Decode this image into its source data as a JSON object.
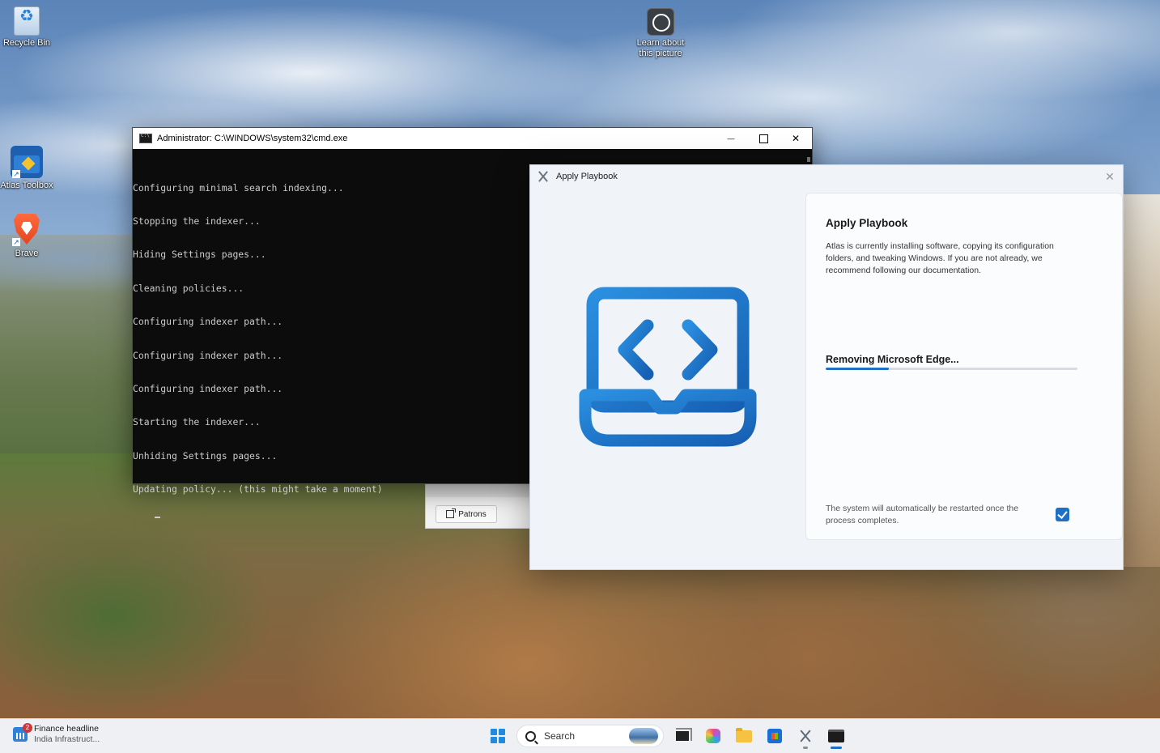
{
  "desktop": {
    "icons": [
      {
        "label": "Recycle Bin"
      },
      {
        "label": "Atlas Toolbox"
      },
      {
        "label": "Brave"
      },
      {
        "label": "Learn about this picture"
      }
    ]
  },
  "cmd": {
    "title": "Administrator: C:\\WINDOWS\\system32\\cmd.exe",
    "lines": [
      "Configuring minimal search indexing...",
      "Stopping the indexer...",
      "Hiding Settings pages...",
      "Cleaning policies...",
      "Configuring indexer path...",
      "Configuring indexer path...",
      "Configuring indexer path...",
      "Starting the indexer...",
      "Unhiding Settings pages...",
      "Updating policy... (this might take a moment)"
    ],
    "minimize_glyph": "—",
    "close_glyph": "✕"
  },
  "behind_window": {
    "patrons_label": "Patrons"
  },
  "playbook": {
    "window_title": "Apply Playbook",
    "close_glyph": "✕",
    "heading": "Apply Playbook",
    "description": "Atlas is currently installing software, copying its configuration folders, and tweaking Windows. If you are not already, we recommend following our documentation.",
    "status": "Removing Microsoft Edge...",
    "progress_fraction": 0.25,
    "restart_note": "The system will automatically be restarted once the process completes.",
    "restart_checked": true,
    "accent_color": "#1f6fc5"
  },
  "taskbar": {
    "widget": {
      "badge": "2",
      "title": "Finance headline",
      "subtitle": "India Infrastruct..."
    },
    "search_placeholder": "Search"
  }
}
